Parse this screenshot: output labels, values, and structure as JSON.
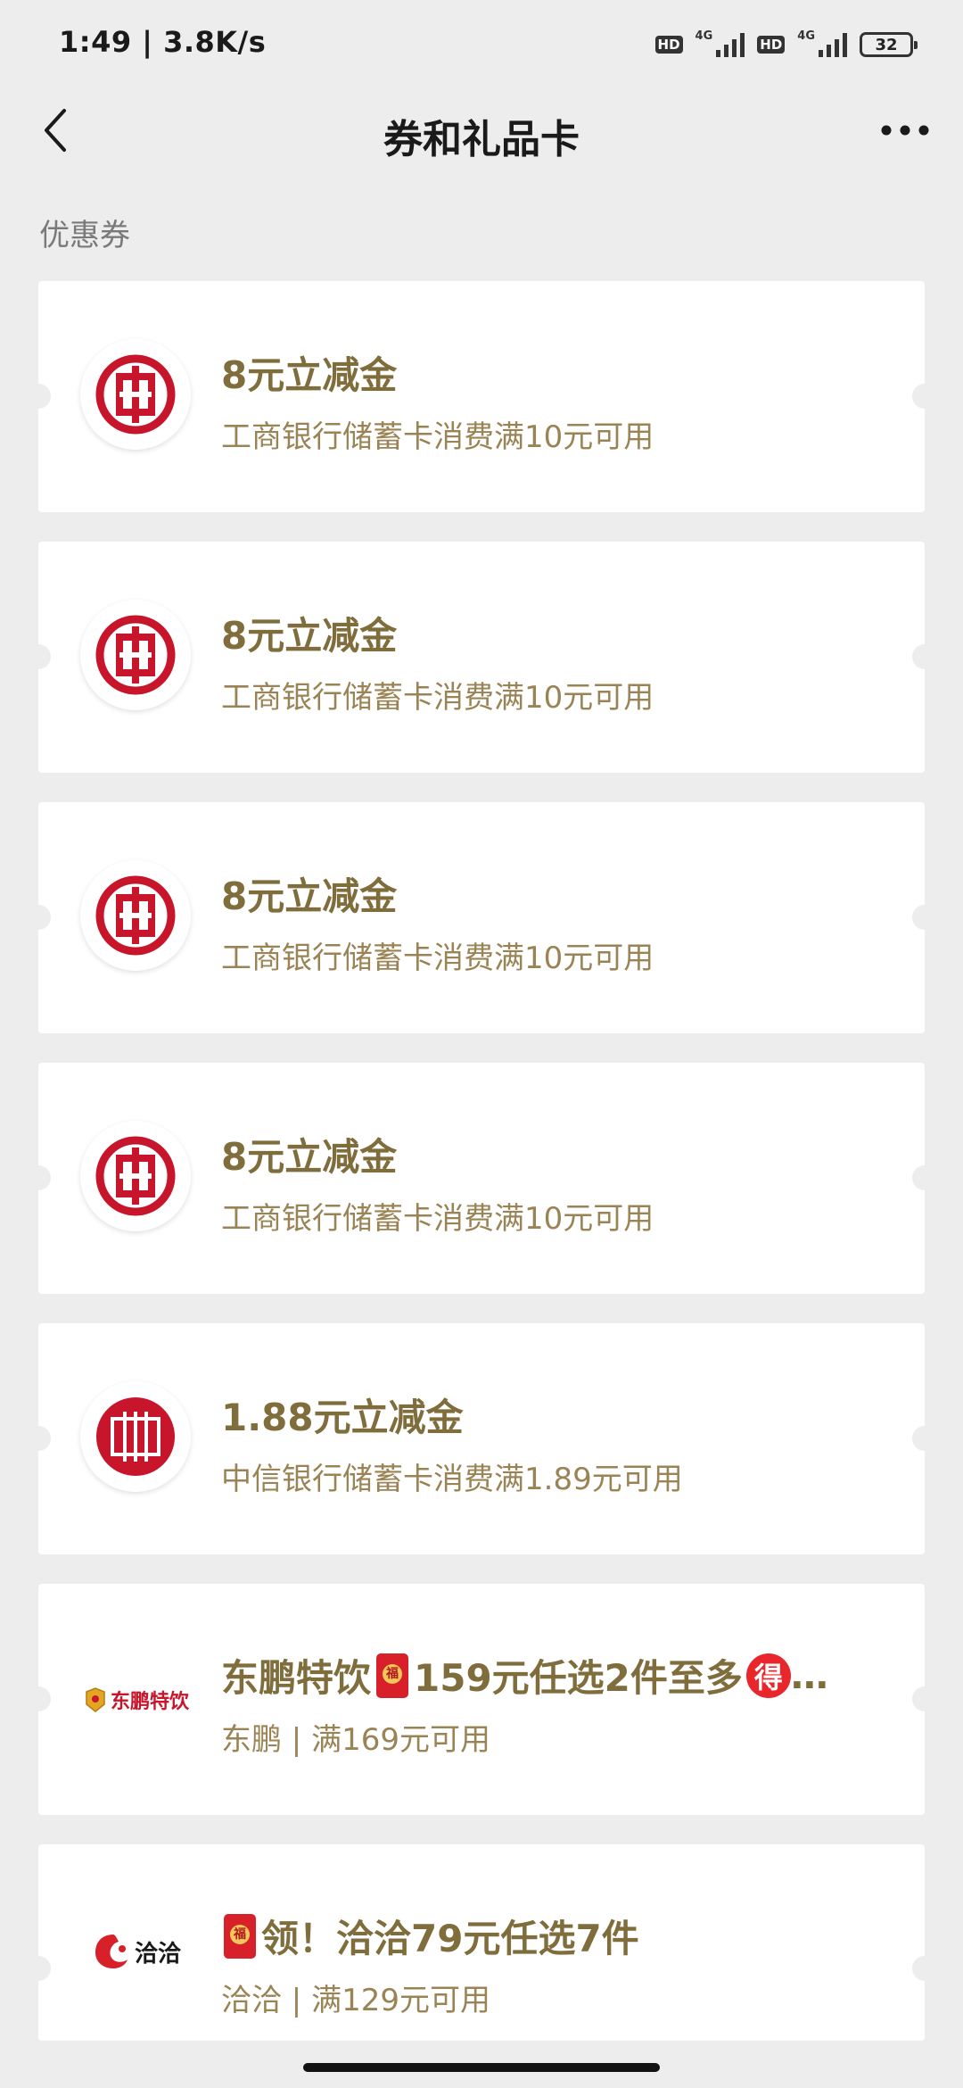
{
  "status_bar": {
    "time": "1:49",
    "speed": "3.8K/s",
    "hd_label": "HD",
    "net_label": "4G",
    "battery": "32"
  },
  "nav": {
    "title": "券和礼品卡"
  },
  "section_label": "优惠券",
  "coupons": [
    {
      "title": "8元立减金",
      "desc": "工商银行储蓄卡消费满10元可用",
      "logo": "icbc-logo"
    },
    {
      "title": "8元立减金",
      "desc": "工商银行储蓄卡消费满10元可用",
      "logo": "icbc-logo"
    },
    {
      "title": "8元立减金",
      "desc": "工商银行储蓄卡消费满10元可用",
      "logo": "icbc-logo"
    },
    {
      "title": "8元立减金",
      "desc": "工商银行储蓄卡消费满10元可用",
      "logo": "icbc-logo"
    },
    {
      "title": "1.88元立减金",
      "desc": "中信银行储蓄卡消费满1.89元可用",
      "logo": "citic-logo"
    },
    {
      "title_part1": "东鹏特饮",
      "title_part2": "159元任选2件至多",
      "title_ellipsis": "…",
      "de_char": "得",
      "desc": "东鹏 | 满169元可用",
      "logo": "dongpeng-logo",
      "logo_text": "东鹏特饮"
    },
    {
      "title_part1": "领！洽洽79元任选7件",
      "desc": "洽洽 | 满129元可用",
      "logo": "qiaqia-logo",
      "logo_text": "洽洽"
    }
  ],
  "colors": {
    "background": "#ededed",
    "card": "#ffffff",
    "title_gold": "#806d3c",
    "desc_gold": "#9a8455",
    "bank_red": "#c7162b"
  }
}
